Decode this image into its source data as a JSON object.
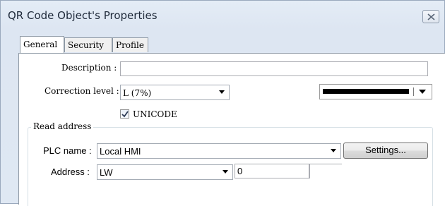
{
  "window": {
    "title": "QR Code Object's Properties"
  },
  "tabs": [
    {
      "label": "General",
      "active": true
    },
    {
      "label": "Security",
      "active": false
    },
    {
      "label": "Profile",
      "active": false
    }
  ],
  "general": {
    "description_label": "Description :",
    "description_value": "",
    "correction_label": "Correction level :",
    "correction_value": "L (7%)",
    "color_value": "#000000",
    "unicode_label": "UNICODE",
    "unicode_checked": true
  },
  "read_address": {
    "group_title": "Read address",
    "plc_label": "PLC name :",
    "plc_value": "Local HMI",
    "settings_label": "Settings...",
    "address_label": "Address :",
    "device_type": "LW",
    "address_value": "0"
  },
  "icons": {
    "close": "close-icon",
    "check": "checkmark-icon"
  }
}
